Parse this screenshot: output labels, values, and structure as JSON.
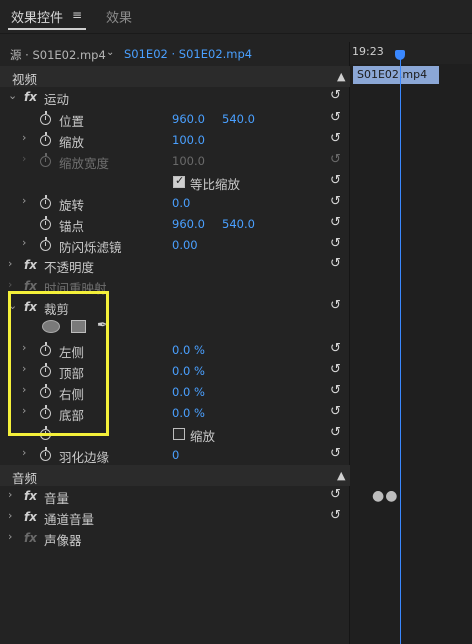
{
  "tabs": {
    "active": "效果控件",
    "active_menu": "≡",
    "inactive": "效果"
  },
  "header": {
    "source": "源 · S01E02.mp4",
    "arrow": "⌄",
    "sequence": "S01E02 · S01E02.mp4",
    "time": "19:23"
  },
  "timeline": {
    "clip_name": "S01E02.mp4",
    "audio_dots": "●●"
  },
  "video": {
    "section_label": "视频",
    "motion": {
      "label": "运动",
      "position": {
        "label": "位置",
        "x": "960.0",
        "y": "540.0"
      },
      "scale": {
        "label": "缩放",
        "value": "100.0"
      },
      "scale_width": {
        "label": "缩放宽度",
        "value": "100.0"
      },
      "uniform_scale": {
        "label": "等比缩放",
        "checked": true
      },
      "rotation": {
        "label": "旋转",
        "value": "0.0"
      },
      "anchor": {
        "label": "锚点",
        "x": "960.0",
        "y": "540.0"
      },
      "antiflicker": {
        "label": "防闪烁滤镜",
        "value": "0.00"
      }
    },
    "opacity": {
      "label": "不透明度"
    },
    "time_remap": {
      "label": "时间重映射"
    },
    "crop": {
      "label": "裁剪",
      "left": {
        "label": "左侧",
        "value": "0.0 %"
      },
      "top": {
        "label": "顶部",
        "value": "0.0 %"
      },
      "right": {
        "label": "右侧",
        "value": "0.0 %"
      },
      "bottom": {
        "label": "底部",
        "value": "0.0 %"
      },
      "zoom": {
        "label": "缩放",
        "checked": false
      },
      "feather": {
        "label": "羽化边缘",
        "value": "0"
      }
    }
  },
  "audio": {
    "section_label": "音频",
    "volume": {
      "label": "音量"
    },
    "channel_volume": {
      "label": "通道音量"
    },
    "panner": {
      "label": "声像器"
    }
  },
  "icons": {
    "fx": "fx",
    "chevron": "›",
    "chevron_open": "⌄",
    "reset": "↺",
    "collapse": "▲",
    "pen": "✒"
  },
  "colors": {
    "highlight": "#f4f03a",
    "value_blue": "#4aa0ff",
    "playhead": "#3a88ff"
  }
}
